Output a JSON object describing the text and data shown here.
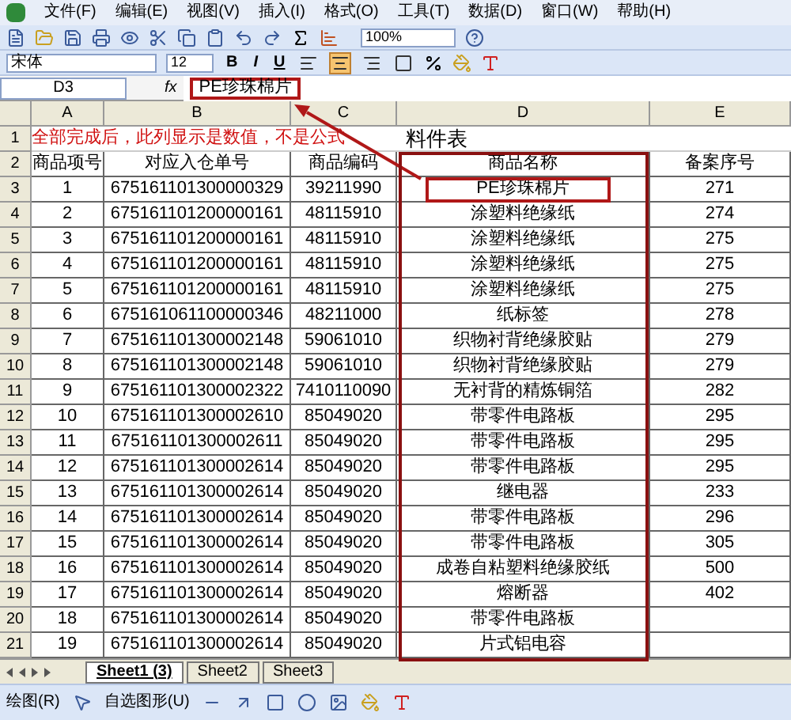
{
  "menu": [
    "文件(F)",
    "编辑(E)",
    "视图(V)",
    "插入(I)",
    "格式(O)",
    "工具(T)",
    "数据(D)",
    "窗口(W)",
    "帮助(H)"
  ],
  "standard_toolbar": {
    "zoom": "100%"
  },
  "format_toolbar": {
    "font": "宋体",
    "size": "12",
    "style_buttons": [
      "B",
      "I",
      "U"
    ],
    "align_buttons": [
      {
        "selected": false
      },
      {
        "selected": true
      },
      {
        "selected": false
      },
      {
        "selected": false
      }
    ]
  },
  "formula_bar": {
    "name_box": "D3",
    "fx": "fx",
    "value": "PE珍珠棉片"
  },
  "sheet": {
    "columns": [
      "A",
      "B",
      "C",
      "D",
      "E"
    ],
    "row_labels": [
      "1",
      "2",
      "3",
      "4",
      "5",
      "6",
      "7",
      "8",
      "9",
      "10",
      "11",
      "12",
      "13",
      "14",
      "15",
      "16",
      "17",
      "18",
      "19",
      "20",
      "21"
    ],
    "title": "料件表",
    "note": "全部完成后，此列显示是数值，不是公式",
    "headers": [
      "商品项号",
      "对应入仓单号",
      "商品编码",
      "商品名称",
      "备案序号"
    ],
    "rows": [
      {
        "cells": [
          "1",
          "675161101300000329",
          "39211990",
          "PE珍珠棉片",
          "271"
        ]
      },
      {
        "cells": [
          "2",
          "675161101200000161",
          "48115910",
          "涂塑料绝缘纸",
          "274"
        ]
      },
      {
        "cells": [
          "3",
          "675161101200000161",
          "48115910",
          "涂塑料绝缘纸",
          "275"
        ]
      },
      {
        "cells": [
          "4",
          "675161101200000161",
          "48115910",
          "涂塑料绝缘纸",
          "275"
        ]
      },
      {
        "cells": [
          "5",
          "675161101200000161",
          "48115910",
          "涂塑料绝缘纸",
          "275"
        ]
      },
      {
        "cells": [
          "6",
          "675161061100000346",
          "48211000",
          "纸标签",
          "278"
        ]
      },
      {
        "cells": [
          "7",
          "675161101300002148",
          "59061010",
          "织物衬背绝缘胶贴",
          "279"
        ]
      },
      {
        "cells": [
          "8",
          "675161101300002148",
          "59061010",
          "织物衬背绝缘胶贴",
          "279"
        ]
      },
      {
        "cells": [
          "9",
          "675161101300002322",
          "7410110090",
          "无衬背的精炼铜箔",
          "282"
        ]
      },
      {
        "cells": [
          "10",
          "675161101300002610",
          "85049020",
          "带零件电路板",
          "295"
        ]
      },
      {
        "cells": [
          "11",
          "675161101300002611",
          "85049020",
          "带零件电路板",
          "295"
        ]
      },
      {
        "cells": [
          "12",
          "675161101300002614",
          "85049020",
          "带零件电路板",
          "295"
        ]
      },
      {
        "cells": [
          "13",
          "675161101300002614",
          "85049020",
          "继电器",
          "233"
        ]
      },
      {
        "cells": [
          "14",
          "675161101300002614",
          "85049020",
          "带零件电路板",
          "296"
        ]
      },
      {
        "cells": [
          "15",
          "675161101300002614",
          "85049020",
          "带零件电路板",
          "305"
        ]
      },
      {
        "cells": [
          "16",
          "675161101300002614",
          "85049020",
          "成卷自粘塑料绝缘胶纸",
          "500"
        ]
      },
      {
        "cells": [
          "17",
          "675161101300002614",
          "85049020",
          "熔断器",
          "402"
        ]
      },
      {
        "cells": [
          "18",
          "675161101300002614",
          "85049020",
          "带零件电路板"
        ]
      },
      {
        "cells": [
          "19",
          "675161101300002614",
          "85049020",
          "片式铝电容"
        ]
      }
    ]
  },
  "sheet_tabs": [
    {
      "label": "Sheet1 (3)",
      "selected": true
    },
    {
      "label": "Sheet2",
      "selected": false
    },
    {
      "label": "Sheet3",
      "selected": false
    }
  ],
  "drawing_toolbar": {
    "draw_menu": "绘图(R)",
    "autoshapes": "自选图形(U)"
  }
}
